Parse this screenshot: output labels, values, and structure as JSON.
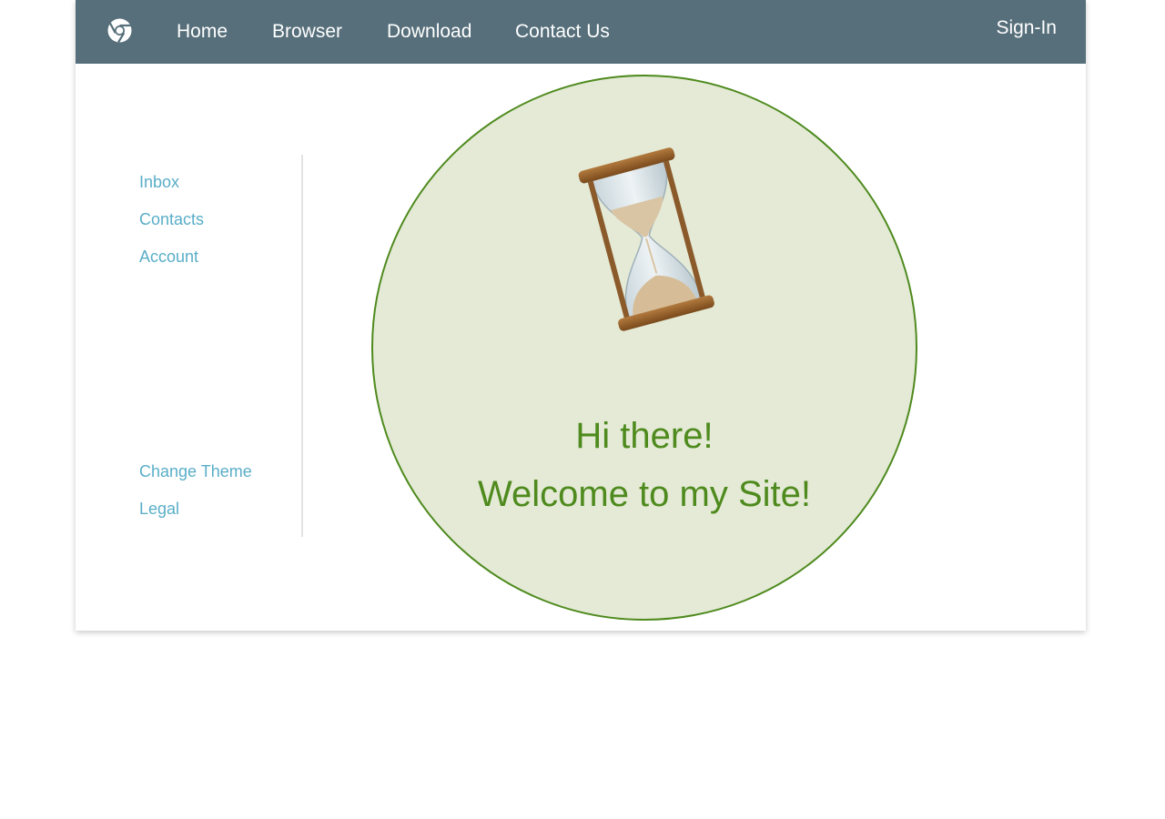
{
  "navbar": {
    "logo_icon": "chrome-logo-icon",
    "links": [
      {
        "label": "Home"
      },
      {
        "label": "Browser"
      },
      {
        "label": "Download"
      },
      {
        "label": "Contact Us"
      }
    ],
    "signin_label": "Sign-In",
    "background_color": "#566f7a"
  },
  "sidebar": {
    "top_items": [
      {
        "label": "Inbox"
      },
      {
        "label": "Contacts"
      },
      {
        "label": "Account"
      }
    ],
    "bottom_items": [
      {
        "label": "Change Theme"
      },
      {
        "label": "Legal"
      }
    ],
    "link_color": "#5aaec8"
  },
  "hero": {
    "image_icon": "hourglass-icon",
    "line1": "Hi there!",
    "line2": "Welcome to my Site!",
    "accent_color": "#4e8a1d",
    "fill_color": "#e4ead6"
  }
}
